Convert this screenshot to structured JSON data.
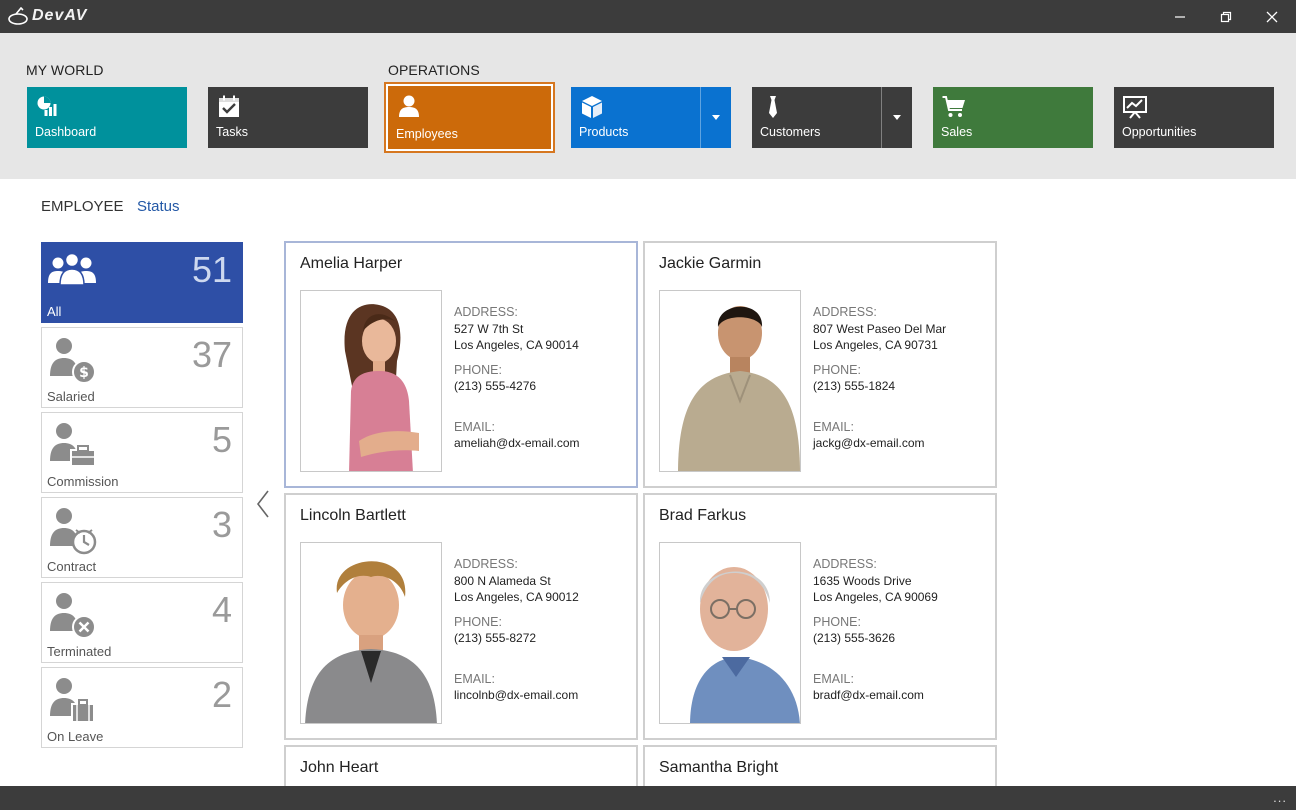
{
  "app": {
    "title": "DevAV"
  },
  "window_controls": [
    "minimize-icon",
    "restore-icon",
    "close-icon"
  ],
  "ribbon": {
    "groups": {
      "my_world": "MY WORLD",
      "operations": "OPERATIONS"
    },
    "tiles": [
      {
        "label": "Dashboard",
        "icon": "dashboard-icon",
        "color": "#00919c"
      },
      {
        "label": "Tasks",
        "icon": "tasks-icon",
        "color": "#3c3c3c"
      },
      {
        "label": "Employees",
        "icon": "employee-icon",
        "color": "#cc6a0a",
        "selected": true
      },
      {
        "label": "Products",
        "icon": "box-icon",
        "color": "#0a72d0",
        "has_dropdown": true
      },
      {
        "label": "Customers",
        "icon": "tie-icon",
        "color": "#3c3c3c",
        "has_dropdown": true
      },
      {
        "label": "Sales",
        "icon": "cart-icon",
        "color": "#3f7a3c"
      },
      {
        "label": "Opportunities",
        "icon": "presentation-icon",
        "color": "#3c3c3c"
      }
    ]
  },
  "tabs": {
    "employee": "EMPLOYEE",
    "status": "Status"
  },
  "filters": [
    {
      "label": "All",
      "count": "51",
      "icon": "group-icon",
      "active": true
    },
    {
      "label": "Salaried",
      "count": "37",
      "icon": "salaried-icon"
    },
    {
      "label": "Commission",
      "count": "5",
      "icon": "commission-icon"
    },
    {
      "label": "Contract",
      "count": "3",
      "icon": "contract-icon"
    },
    {
      "label": "Terminated",
      "count": "4",
      "icon": "terminated-icon"
    },
    {
      "label": "On Leave",
      "count": "2",
      "icon": "on-leave-icon"
    }
  ],
  "labels": {
    "address": "ADDRESS:",
    "phone": "PHONE:",
    "email": "EMAIL:"
  },
  "employees": [
    {
      "name": "Amelia Harper",
      "address1": "527 W 7th St",
      "address2": "Los Angeles, CA 90014",
      "phone": "(213) 555-4276",
      "email": "ameliah@dx-email.com",
      "selected": true
    },
    {
      "name": "Jackie Garmin",
      "address1": "807 West Paseo Del Mar",
      "address2": "Los Angeles, CA 90731",
      "phone": "(213) 555-1824",
      "email": "jackg@dx-email.com"
    },
    {
      "name": "Lincoln Bartlett",
      "address1": "800 N Alameda St",
      "address2": "Los Angeles, CA 90012",
      "phone": "(213) 555-8272",
      "email": "lincolnb@dx-email.com"
    },
    {
      "name": "Brad Farkus",
      "address1": "1635 Woods Drive",
      "address2": "Los Angeles, CA 90069",
      "phone": "(213) 555-3626",
      "email": "bradf@dx-email.com"
    },
    {
      "name": "John Heart"
    },
    {
      "name": "Samantha Bright"
    }
  ],
  "statusbar": {
    "more": "..."
  }
}
